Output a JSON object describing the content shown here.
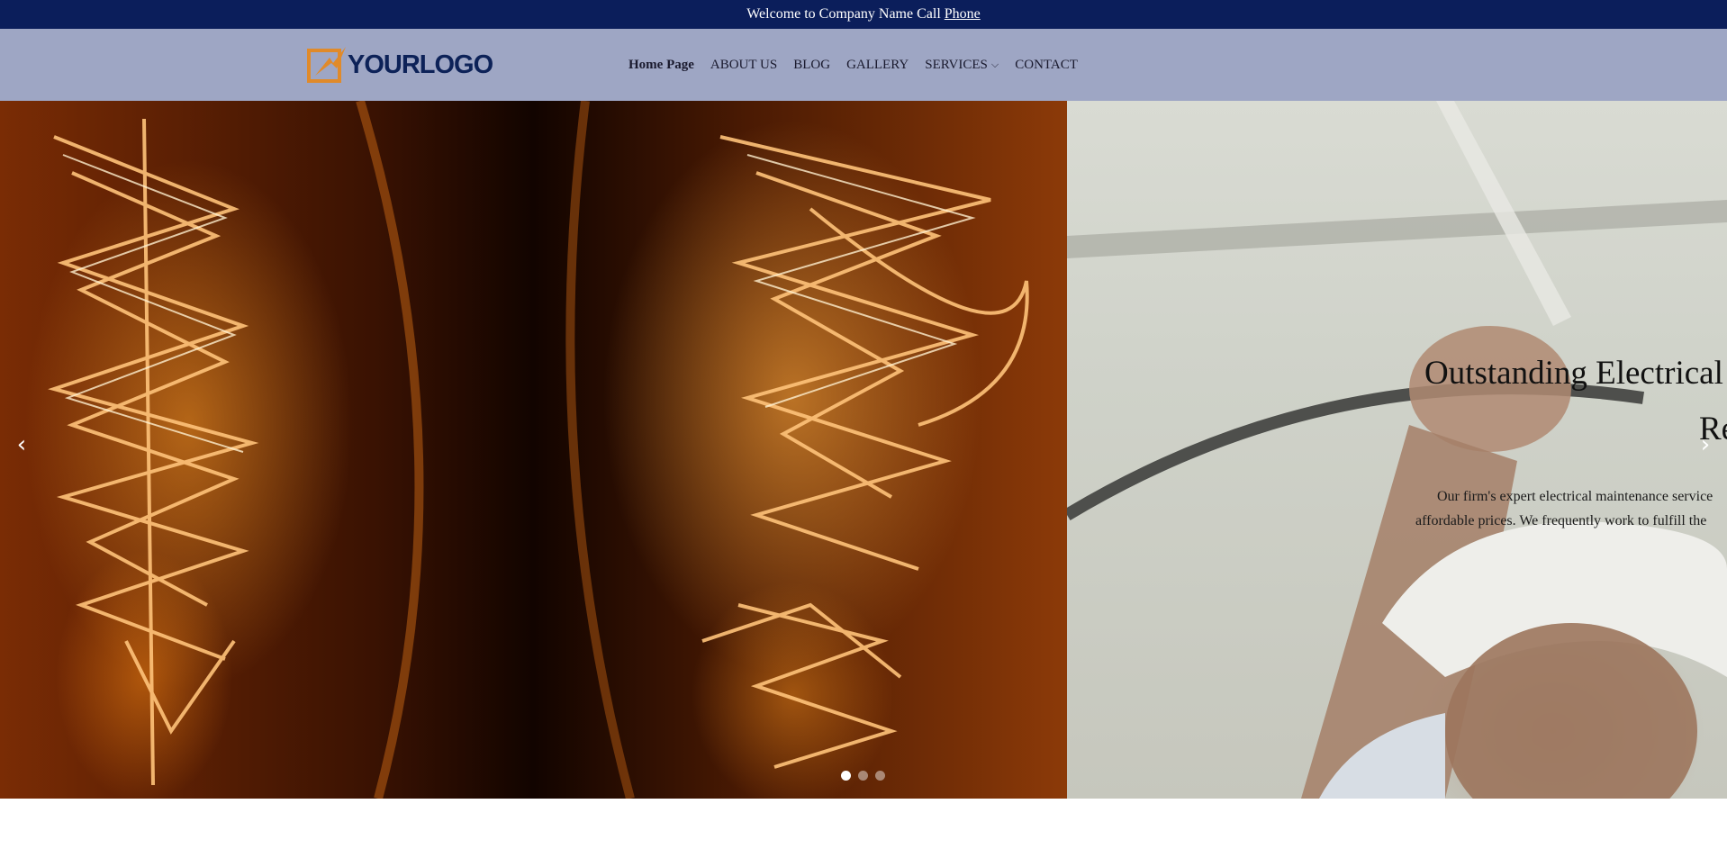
{
  "topbar": {
    "welcome_text": "Welcome to Company Name Call",
    "phone_link": "Phone"
  },
  "header": {
    "logo_text": "YOURLOGO",
    "nav": [
      {
        "label": "Home Page",
        "active": true
      },
      {
        "label": "ABOUT US"
      },
      {
        "label": "BLOG"
      },
      {
        "label": "GALLERY"
      },
      {
        "label": "SERVICES",
        "has_dropdown": true
      },
      {
        "label": "CONTACT"
      }
    ]
  },
  "hero": {
    "title_line1": "Outstanding Electrical",
    "title_line2": "Re",
    "text_line1": "Our firm's expert electrical maintenance service",
    "text_line2": "affordable prices. We frequently work to fulfill the",
    "prev_icon": "chevron-left-icon",
    "next_icon": "chevron-right-icon",
    "slides_count": 3,
    "active_slide": 1
  },
  "colors": {
    "topbar_bg": "#0b1e5b",
    "header_bg": "#9ea6c4",
    "logo_text": "#0d2258",
    "logo_accent": "#e08a2a"
  }
}
